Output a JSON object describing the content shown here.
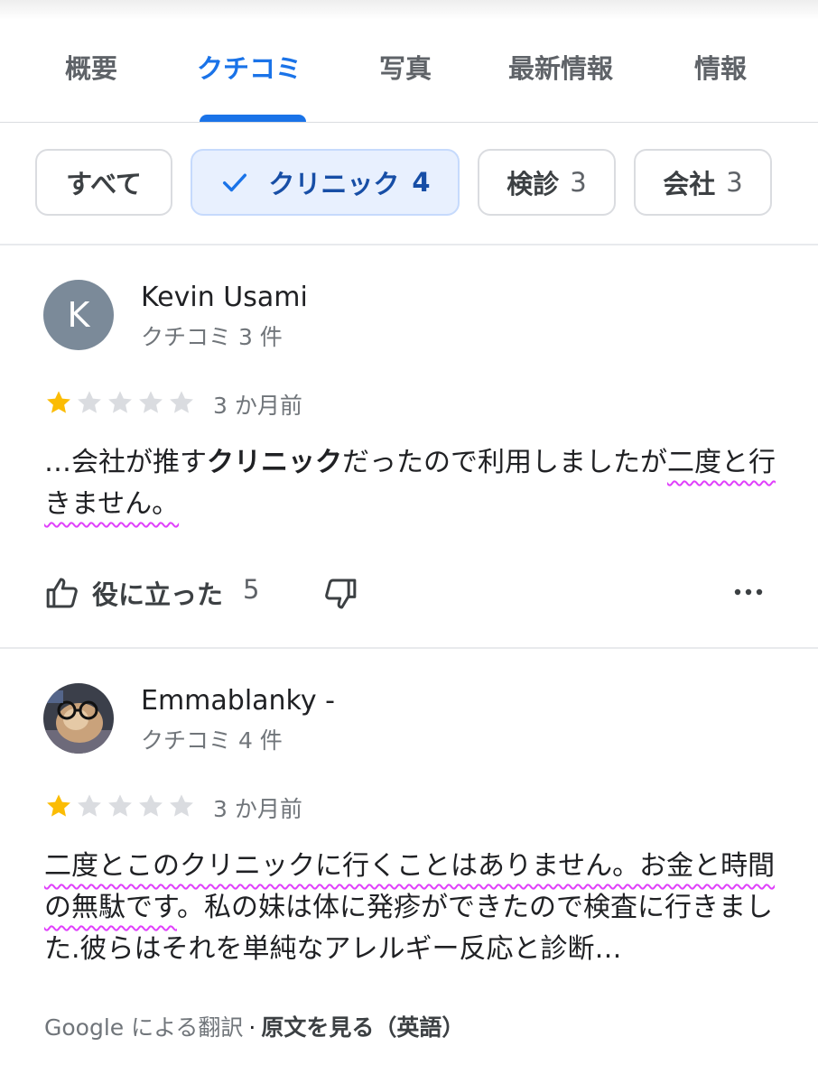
{
  "tabs": [
    {
      "label": "概要",
      "active": false
    },
    {
      "label": "クチコミ",
      "active": true
    },
    {
      "label": "写真",
      "active": false
    },
    {
      "label": "最新情報",
      "active": false
    },
    {
      "label": "情報",
      "active": false
    }
  ],
  "chips": [
    {
      "label": "すべて",
      "count": "",
      "selected": false
    },
    {
      "label": "クリニック",
      "count": "4",
      "selected": true
    },
    {
      "label": "検診",
      "count": "3",
      "selected": false
    },
    {
      "label": "会社",
      "count": "3",
      "selected": false
    }
  ],
  "colors": {
    "accent": "#1a73e8",
    "star_filled": "#fbbc04",
    "star_empty": "#dadce0",
    "underline_highlight": "#e040fb"
  },
  "reviews": [
    {
      "author": "Kevin Usami",
      "avatar_letter": "K",
      "review_count": "クチコミ 3 件",
      "rating": 1,
      "rating_max": 5,
      "date": "3 か月前",
      "text_prefix": "…会社が推す",
      "text_bold": "クリニック",
      "text_mid": "だったので利用しましたが",
      "text_underlined": "二度と行きません。",
      "helpful_label": "役に立った",
      "helpful_count": "5"
    },
    {
      "author": "Emmablanky -",
      "avatar_icon": "profile-photo-glasses",
      "review_count": "クチコミ 4 件",
      "rating": 1,
      "rating_max": 5,
      "date": "3 か月前",
      "text_underlined": "二度とこのクリニックに行くことはありません。お金と時間の無駄です",
      "text_rest": "。私の妹は体に発疹ができたので検査に行きました.彼らはそれを単純なアレルギー反応と診断…",
      "translation_source": "Google",
      "translation_label": "による翻訳",
      "translation_sep": "·",
      "translation_link": "原文を見る（英語）"
    }
  ]
}
